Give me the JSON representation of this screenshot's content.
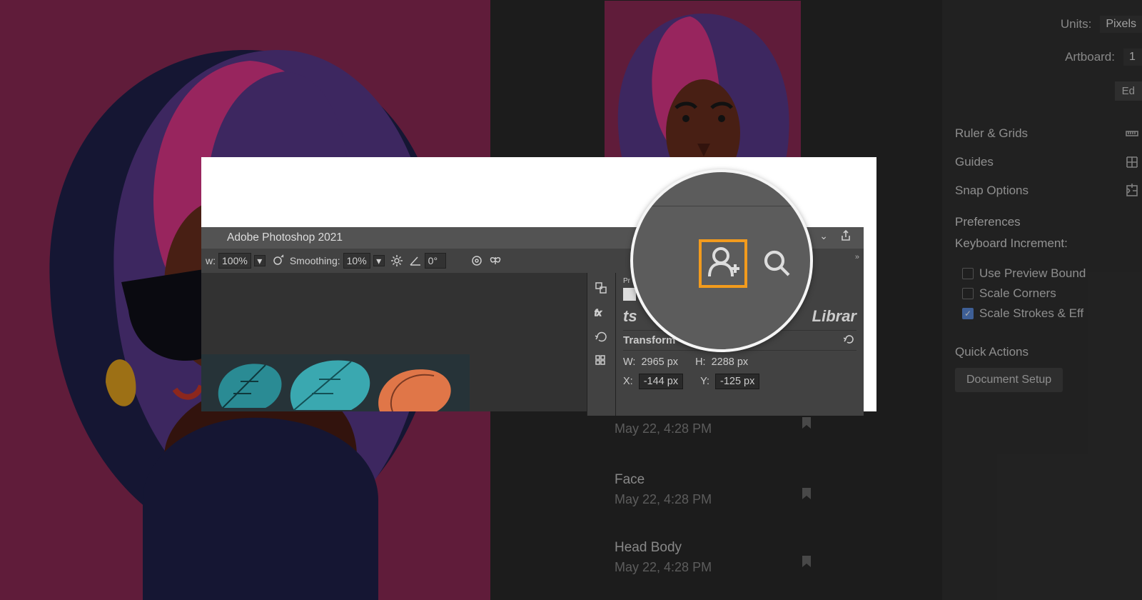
{
  "right_panel": {
    "units_label": "Units:",
    "units_value": "Pixels",
    "artboard_label": "Artboard:",
    "artboard_value": "1",
    "edit_label": "Ed",
    "ruler_label": "Ruler & Grids",
    "guides_label": "Guides",
    "snap_label": "Snap Options",
    "preferences_label": "Preferences",
    "keyboard_increment_label": "Keyboard Increment:",
    "cb_preview_label": "Use Preview Bound",
    "cb_scale_corners_label": "Scale Corners",
    "cb_scale_strokes_label": "Scale Strokes & Eff",
    "quick_actions_label": "Quick Actions",
    "doc_setup_label": "Document Setup"
  },
  "versions": [
    {
      "name_partial": "",
      "time": "May 22, 4:28 PM"
    },
    {
      "name": "Face",
      "time": "May 22, 4:28 PM"
    },
    {
      "name": "Head Body",
      "time": "May 22, 4:28 PM"
    }
  ],
  "inset": {
    "app_title": "Adobe Photoshop 2021",
    "toolbar": {
      "view_label": "w:",
      "view_value": "100%",
      "smoothing_label": "Smoothing:",
      "smoothing_value": "10%",
      "angle_value": "0°"
    },
    "panel": {
      "p_label": "Pr",
      "tabs_left": "ts",
      "tabs_right": "Librar",
      "transform_label": "Transform",
      "w_label": "W:",
      "w_value": "2965 px",
      "h_label": "H:",
      "h_value": "2288 px",
      "x_label": "X:",
      "x_value": "-144 px",
      "y_label": "Y:",
      "y_value": "-125 px"
    }
  }
}
